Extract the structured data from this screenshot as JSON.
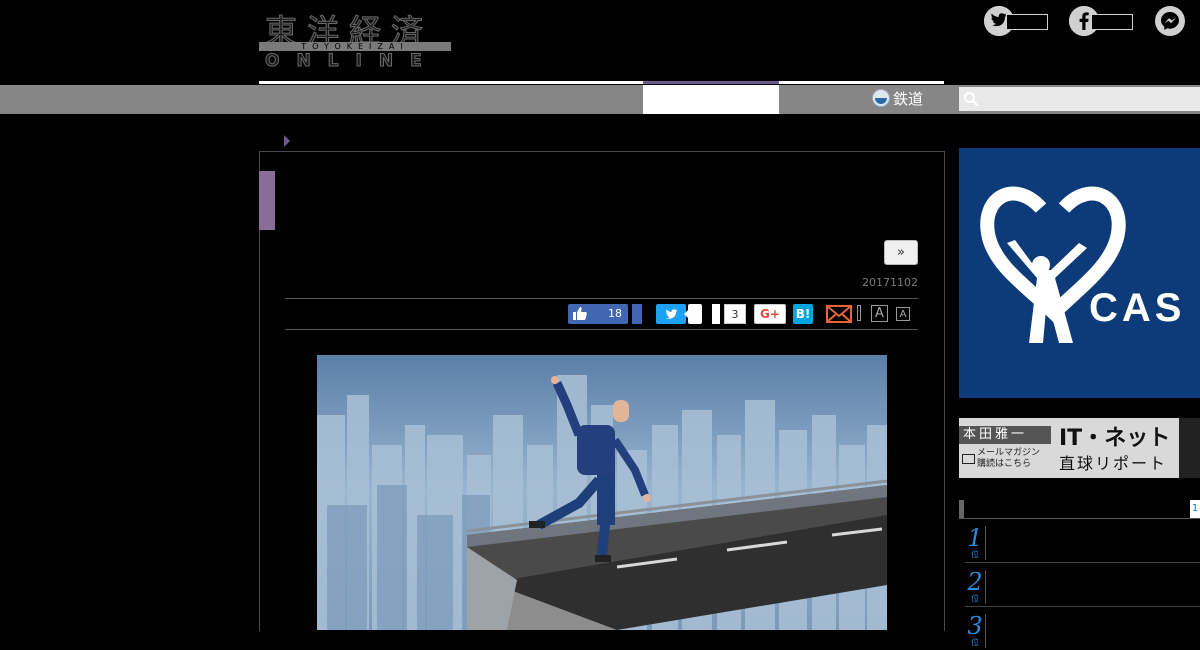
{
  "header": {
    "logo_kanji": "東洋経済",
    "logo_band": "TOYOKEIZAI",
    "logo_online": "ONLINE",
    "social": [
      {
        "icon": "twitter-icon",
        "glyph": "🐦"
      },
      {
        "icon": "facebook-icon",
        "glyph": "f"
      },
      {
        "icon": "messenger-icon",
        "glyph": "m"
      }
    ]
  },
  "nav": {
    "rail_label": "鉄道",
    "rail_icon": "train-icon",
    "search_icon": "search-icon",
    "accent_color": "#6b5b8a"
  },
  "article": {
    "next_label": "»",
    "date": "20171102",
    "share": {
      "fb_like_count": "18",
      "gplus_count": "3",
      "gplus_label": "G+",
      "hatena_label": "B!",
      "font_large": "A",
      "font_small": "A"
    },
    "photo_desc_icon": "businessman-bridge-image"
  },
  "sidebar": {
    "cas_ad": {
      "brand": "CAS",
      "reg": "®",
      "bg": "#0d3a78"
    },
    "mail_ad": {
      "name": "本田雅一",
      "sub1": "メールマガジン",
      "sub2": "購読はこちら",
      "title1": "IT・ネット",
      "title2": "直球リポート"
    },
    "ranking": {
      "tab": "1",
      "items": [
        {
          "num": "1",
          "suffix": "位"
        },
        {
          "num": "2",
          "suffix": "位"
        },
        {
          "num": "3",
          "suffix": "位"
        }
      ]
    }
  }
}
